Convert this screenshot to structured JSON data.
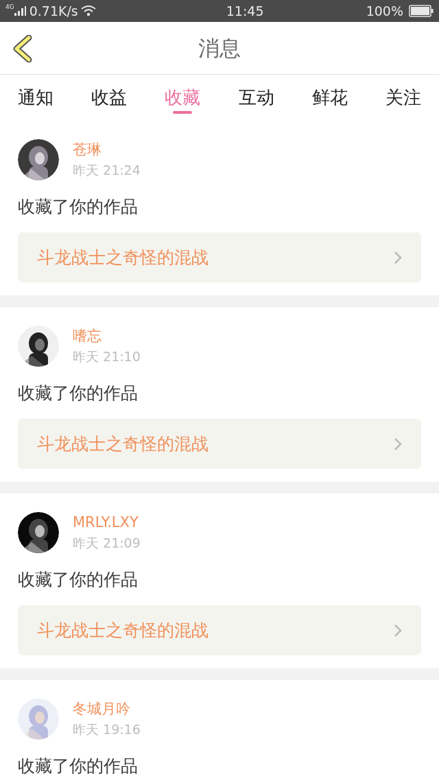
{
  "status_bar": {
    "network": "4G",
    "speed": "0.71K/s",
    "time": "11:45",
    "battery": "100%"
  },
  "header": {
    "title": "消息"
  },
  "tabs": [
    {
      "label": "通知",
      "selected": false
    },
    {
      "label": "收益",
      "selected": false
    },
    {
      "label": "收藏",
      "selected": true
    },
    {
      "label": "互动",
      "selected": false
    },
    {
      "label": "鲜花",
      "selected": false
    },
    {
      "label": "关注",
      "selected": false
    }
  ],
  "messages": [
    {
      "name": "苍琳",
      "time": "昨天 21:24",
      "text": "收藏了你的作品",
      "work": "斗龙战士之奇怪的混战"
    },
    {
      "name": "嗜忘",
      "time": "昨天 21:10",
      "text": "收藏了你的作品",
      "work": "斗龙战士之奇怪的混战"
    },
    {
      "name": "MRLY.LXY",
      "time": "昨天 21:09",
      "text": "收藏了你的作品",
      "work": "斗龙战士之奇怪的混战"
    },
    {
      "name": "冬城月吟",
      "time": "昨天 19:16",
      "text": "收藏了你的作品"
    }
  ]
}
